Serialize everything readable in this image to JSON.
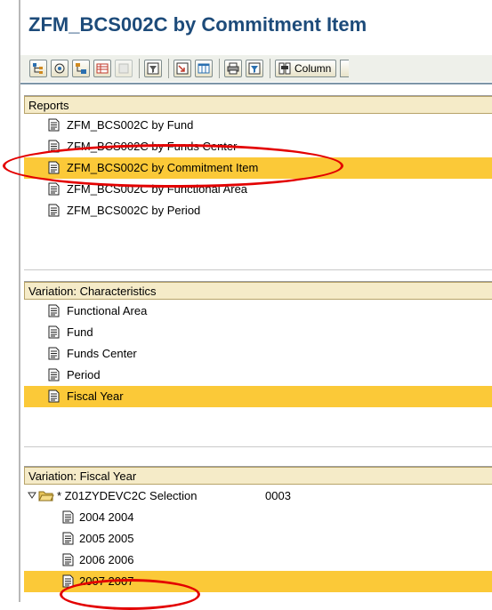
{
  "header": {
    "title": "ZFM_BCS002C by Commitment Item"
  },
  "toolbar": {
    "buttons": [
      "hierarchy-icon",
      "expand-icon",
      "tree-icon",
      "table-icon",
      "table-disabled-icon",
      "filter-icon",
      "drilldown-icon",
      "columns-icon",
      "print-icon",
      "export-icon"
    ],
    "column_label": "Column"
  },
  "reports": {
    "header": "Reports",
    "items": [
      {
        "label": "ZFM_BCS002C by Fund",
        "selected": false
      },
      {
        "label": "ZFM_BCS002C by Funds Center",
        "selected": false
      },
      {
        "label": "ZFM_BCS002C by Commitment Item",
        "selected": true
      },
      {
        "label": "ZFM_BCS002C by Functional Area",
        "selected": false
      },
      {
        "label": "ZFM_BCS002C by Period",
        "selected": false
      }
    ]
  },
  "characteristics": {
    "header": "Variation: Characteristics",
    "items": [
      {
        "label": "Functional Area",
        "selected": false
      },
      {
        "label": "Fund",
        "selected": false
      },
      {
        "label": "Funds Center",
        "selected": false
      },
      {
        "label": "Period",
        "selected": false
      },
      {
        "label": "Fiscal Year",
        "selected": true
      }
    ]
  },
  "fiscal_year": {
    "header": "Variation: Fiscal Year",
    "folder": {
      "label": "* Z01ZYDEVC2C Selection",
      "code": "0003"
    },
    "items": [
      {
        "label": "2004 2004",
        "selected": false
      },
      {
        "label": "2005 2005",
        "selected": false
      },
      {
        "label": "2006 2006",
        "selected": false
      },
      {
        "label": "2007 2007",
        "selected": true
      }
    ]
  },
  "colors": {
    "selection": "#fbc938",
    "annotation": "#e30000",
    "header_bg": "#f5ebc8",
    "title": "#1d4b7a"
  }
}
